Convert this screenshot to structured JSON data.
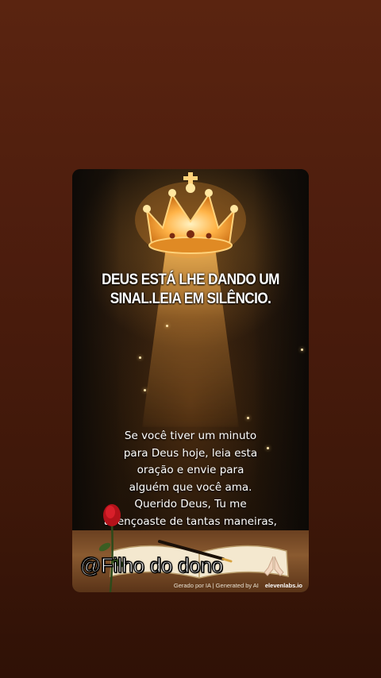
{
  "post": {
    "headline_line1": "DEUS ESTÁ LHE DANDO UM",
    "headline_line2": "SINAL.LEIA EM SILÊNCIO.",
    "prayer_lines": [
      "Se você tiver um minuto",
      "para Deus hoje, leia esta",
      "oração e envie para",
      "alguém que você ama.",
      "Querido Deus, Tu me",
      "abençoaste de tantas maneiras,"
    ],
    "watermark_handle": "@Filho do dono",
    "credit_text": "Gerado por IA | Generated by AI",
    "credit_brand": "elevenlabs.io",
    "icons": {
      "crown": "crown-icon",
      "pray": "praying-hands-icon",
      "rose": "rose-icon",
      "book": "open-book-icon"
    },
    "colors": {
      "background": "#4b1c0d",
      "text": "#ffffff",
      "gold": "#ffb347"
    }
  }
}
